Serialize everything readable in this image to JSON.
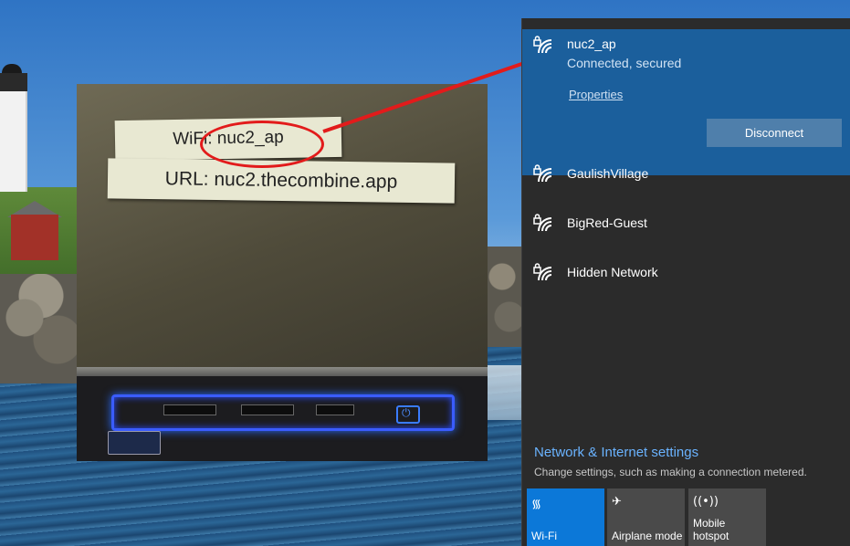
{
  "photo": {
    "wifi_label": "WiFi: nuc2_ap",
    "url_label": "URL: nuc2.thecombine.app"
  },
  "flyout": {
    "connected_network": {
      "name": "nuc2_ap",
      "status": "Connected, secured",
      "properties_label": "Properties",
      "disconnect_label": "Disconnect"
    },
    "networks": [
      {
        "name": "GaulishVillage"
      },
      {
        "name": "BigRed-Guest"
      },
      {
        "name": "Hidden Network"
      }
    ],
    "settings": {
      "title": "Network & Internet settings",
      "description": "Change settings, such as making a connection metered."
    },
    "quick_actions": [
      {
        "label": "Wi-Fi",
        "icon": "wifi-icon",
        "active": true
      },
      {
        "label": "Airplane mode",
        "icon": "airplane-icon",
        "active": false
      },
      {
        "label": "Mobile hotspot",
        "icon": "hotspot-icon",
        "active": false
      }
    ]
  },
  "colors": {
    "connected_bg": "#1b5f9c",
    "flyout_bg": "#2b2b2b",
    "active_tile": "#0c78d8",
    "link": "#6ab3ff",
    "arrow": "#e21b1b"
  }
}
